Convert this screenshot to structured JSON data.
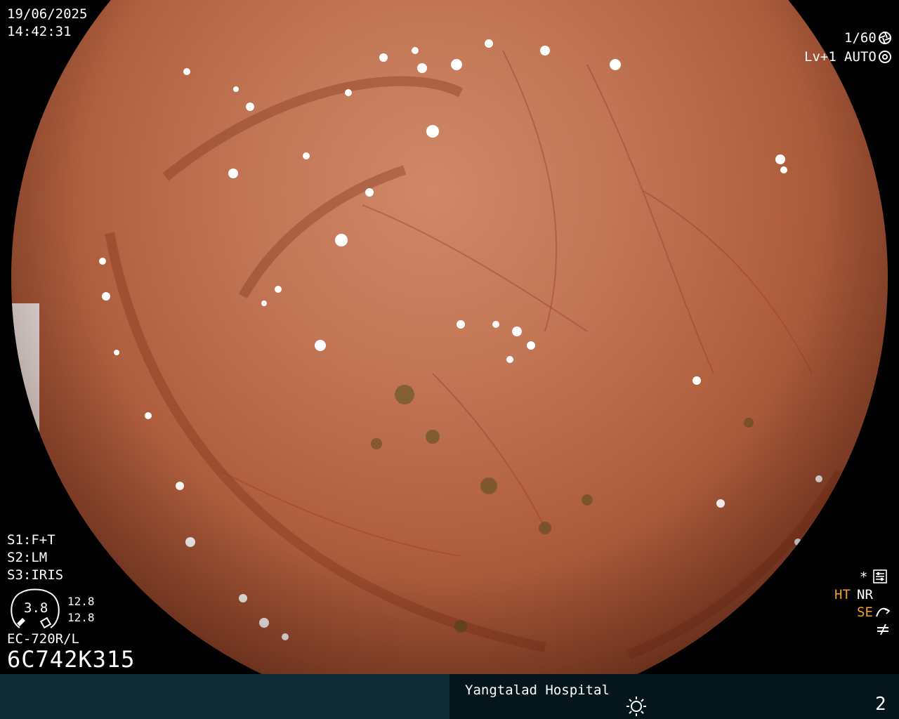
{
  "header": {
    "date": "19/06/2025",
    "time": "14:42:31",
    "shutter": "1/60",
    "shutter_icon": "shutter-icon",
    "level": "Lv+1",
    "exposure": "AUTO",
    "exposure_icon": "aperture-icon"
  },
  "settings": {
    "s1": "S1:F+T",
    "s2": "S2:LM",
    "s3": "S3:IRIS"
  },
  "scope_info": {
    "gauge_value": "3.8",
    "gauge_top": "12.8",
    "gauge_bottom": "12.8",
    "model": "EC-720R/L",
    "serial": "6C742K315"
  },
  "modes": {
    "star": "*",
    "star_icon": "settings-panel-icon",
    "ht": "HT",
    "nr": "NR",
    "se": "SE",
    "se_icon": "mode-curve-icon",
    "freeze_icon": "not-equal-icon"
  },
  "footer": {
    "hospital": "Yangtalad Hospital",
    "brightness_icon": "sun-icon",
    "page_number": "2"
  },
  "colors": {
    "accent": "#f0a030",
    "bar": "#0f2b34",
    "bar_dark": "#04151b"
  }
}
